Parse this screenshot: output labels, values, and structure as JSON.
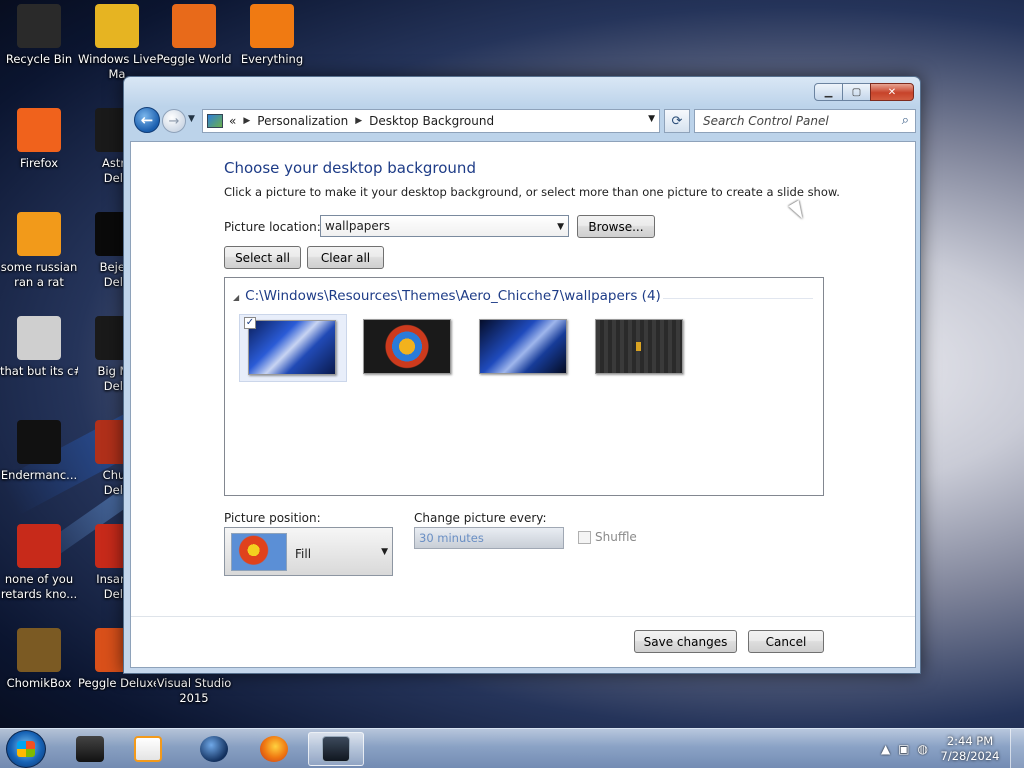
{
  "desktop": {
    "icons": [
      {
        "label": "Recycle Bin",
        "label2": "",
        "color": "#2a2a2a"
      },
      {
        "label": "Windows Live",
        "label2": "Ma",
        "color": "#e6b422"
      },
      {
        "label": "Peggle World",
        "label2": "",
        "color": "#e86a1a"
      },
      {
        "label": "Everything",
        "label2": "",
        "color": "#f07a12"
      },
      {
        "label": "Firefox",
        "label2": "",
        "color": "#f0621c"
      },
      {
        "label": "Astro",
        "label2": "Delu",
        "color": "#1a1a1a"
      },
      {
        "label": "some russian",
        "label2": "ran a rat",
        "color": "#f29a1a"
      },
      {
        "label": "Bejew",
        "label2": "Delu",
        "color": "#0a0a0a"
      },
      {
        "label": "that but its c#",
        "label2": "",
        "color": "#cfcfcf"
      },
      {
        "label": "Big Mo",
        "label2": "Delu",
        "color": "#1a1a1a"
      },
      {
        "label": "Endermanc...",
        "label2": "",
        "color": "#111111"
      },
      {
        "label": "Chuz",
        "label2": "Delu",
        "color": "#b0301a"
      },
      {
        "label": "none of you",
        "label2": "retards kno...",
        "color": "#c72a1a"
      },
      {
        "label": "Insaniq",
        "label2": "Delu",
        "color": "#c72a1a"
      },
      {
        "label": "ChomikBox",
        "label2": "",
        "color": "#7b5a23"
      },
      {
        "label": "Peggle Deluxe",
        "label2": "",
        "color": "#d9501a"
      },
      {
        "label": "Visual Studio",
        "label2": "2015",
        "color": "#1a1a1a"
      }
    ]
  },
  "window": {
    "controls": {
      "minimize": "▁",
      "maximize": "▢",
      "close": "✕"
    },
    "nav": {
      "back_icon": "back-arrow-icon",
      "forward_icon": "forward-arrow-icon",
      "chevrons": "«",
      "breadcrumb": [
        "Personalization",
        "Desktop Background"
      ],
      "search_placeholder": "Search Control Panel"
    },
    "heading": "Choose your desktop background",
    "description": "Click a picture to make it your desktop background, or select more than one picture to create a slide show.",
    "picture_location_label": "Picture location:",
    "picture_location_value": "wallpapers",
    "browse_label": "Browse...",
    "select_all_label": "Select all",
    "clear_all_label": "Clear all",
    "group_header": "C:\\Windows\\Resources\\Themes\\Aero_Chicche7\\wallpapers (4)",
    "thumbnails": [
      {
        "selected": true
      },
      {
        "selected": false
      },
      {
        "selected": false
      },
      {
        "selected": false
      }
    ],
    "picture_position_label": "Picture position:",
    "picture_position_value": "Fill",
    "change_every_label": "Change picture every:",
    "change_every_value": "30 minutes",
    "shuffle_label": "Shuffle",
    "save_label": "Save changes",
    "cancel_label": "Cancel"
  },
  "taskbar": {
    "time": "2:44 PM",
    "date": "7/28/2024"
  },
  "colors": {
    "accent": "#1e3c87",
    "close": "#c7432a"
  }
}
